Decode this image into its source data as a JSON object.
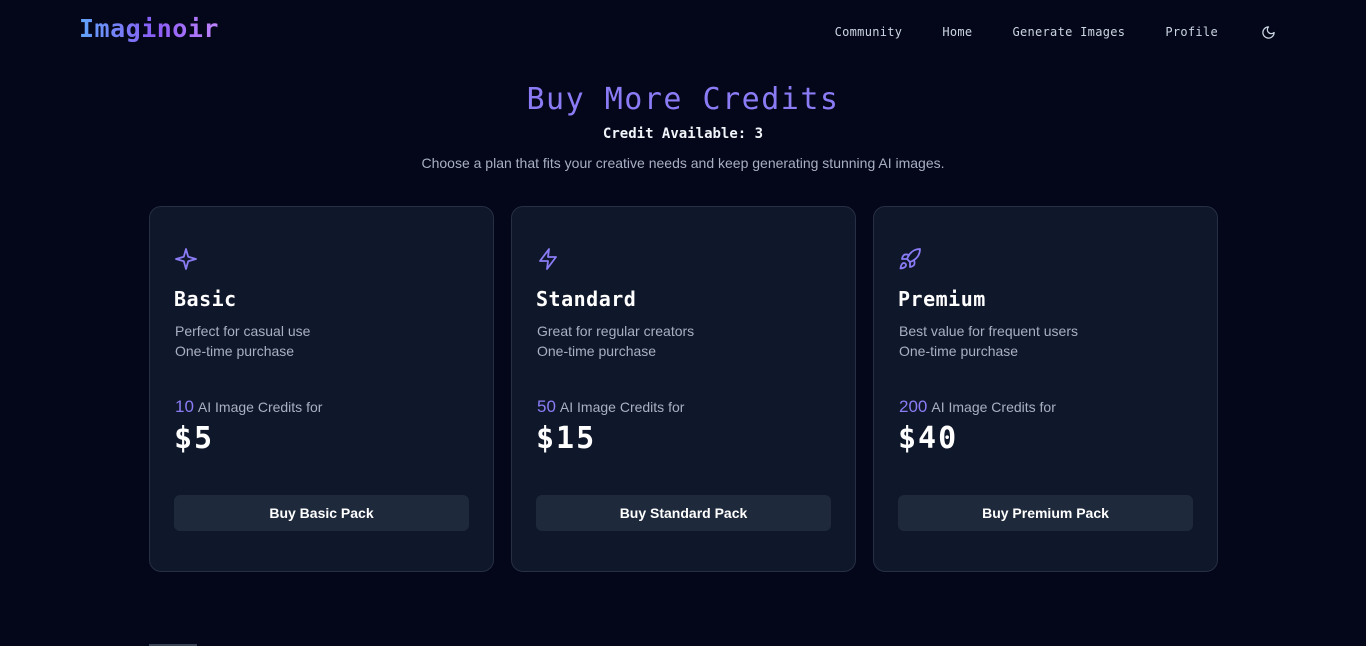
{
  "header": {
    "logo": "Imaginoir",
    "nav": [
      "Community",
      "Home",
      "Generate Images",
      "Profile"
    ],
    "theme_icon": "moon-icon"
  },
  "hero": {
    "title": "Buy More Credits",
    "credits_label": "Credit Available: 3",
    "subtitle": "Choose a plan that fits your creative needs and keep generating stunning AI images."
  },
  "plans": [
    {
      "icon": "sparkle-icon",
      "name": "Basic",
      "desc_line1": "Perfect for casual use",
      "desc_line2": "One-time purchase",
      "credits": "10",
      "credits_label": "AI Image Credits for",
      "price": "$5",
      "button": "Buy Basic Pack"
    },
    {
      "icon": "lightning-icon",
      "name": "Standard",
      "desc_line1": "Great for regular creators",
      "desc_line2": "One-time purchase",
      "credits": "50",
      "credits_label": "AI Image Credits for",
      "price": "$15",
      "button": "Buy Standard Pack"
    },
    {
      "icon": "rocket-icon",
      "name": "Premium",
      "desc_line1": "Best value for frequent users",
      "desc_line2": "One-time purchase",
      "credits": "200",
      "credits_label": "AI Image Credits for",
      "price": "$40",
      "button": "Buy Premium Pack"
    }
  ],
  "colors": {
    "background": "#04061a",
    "card": "#0f172a",
    "accent": "#8b7cf6",
    "button": "#1e293b"
  }
}
